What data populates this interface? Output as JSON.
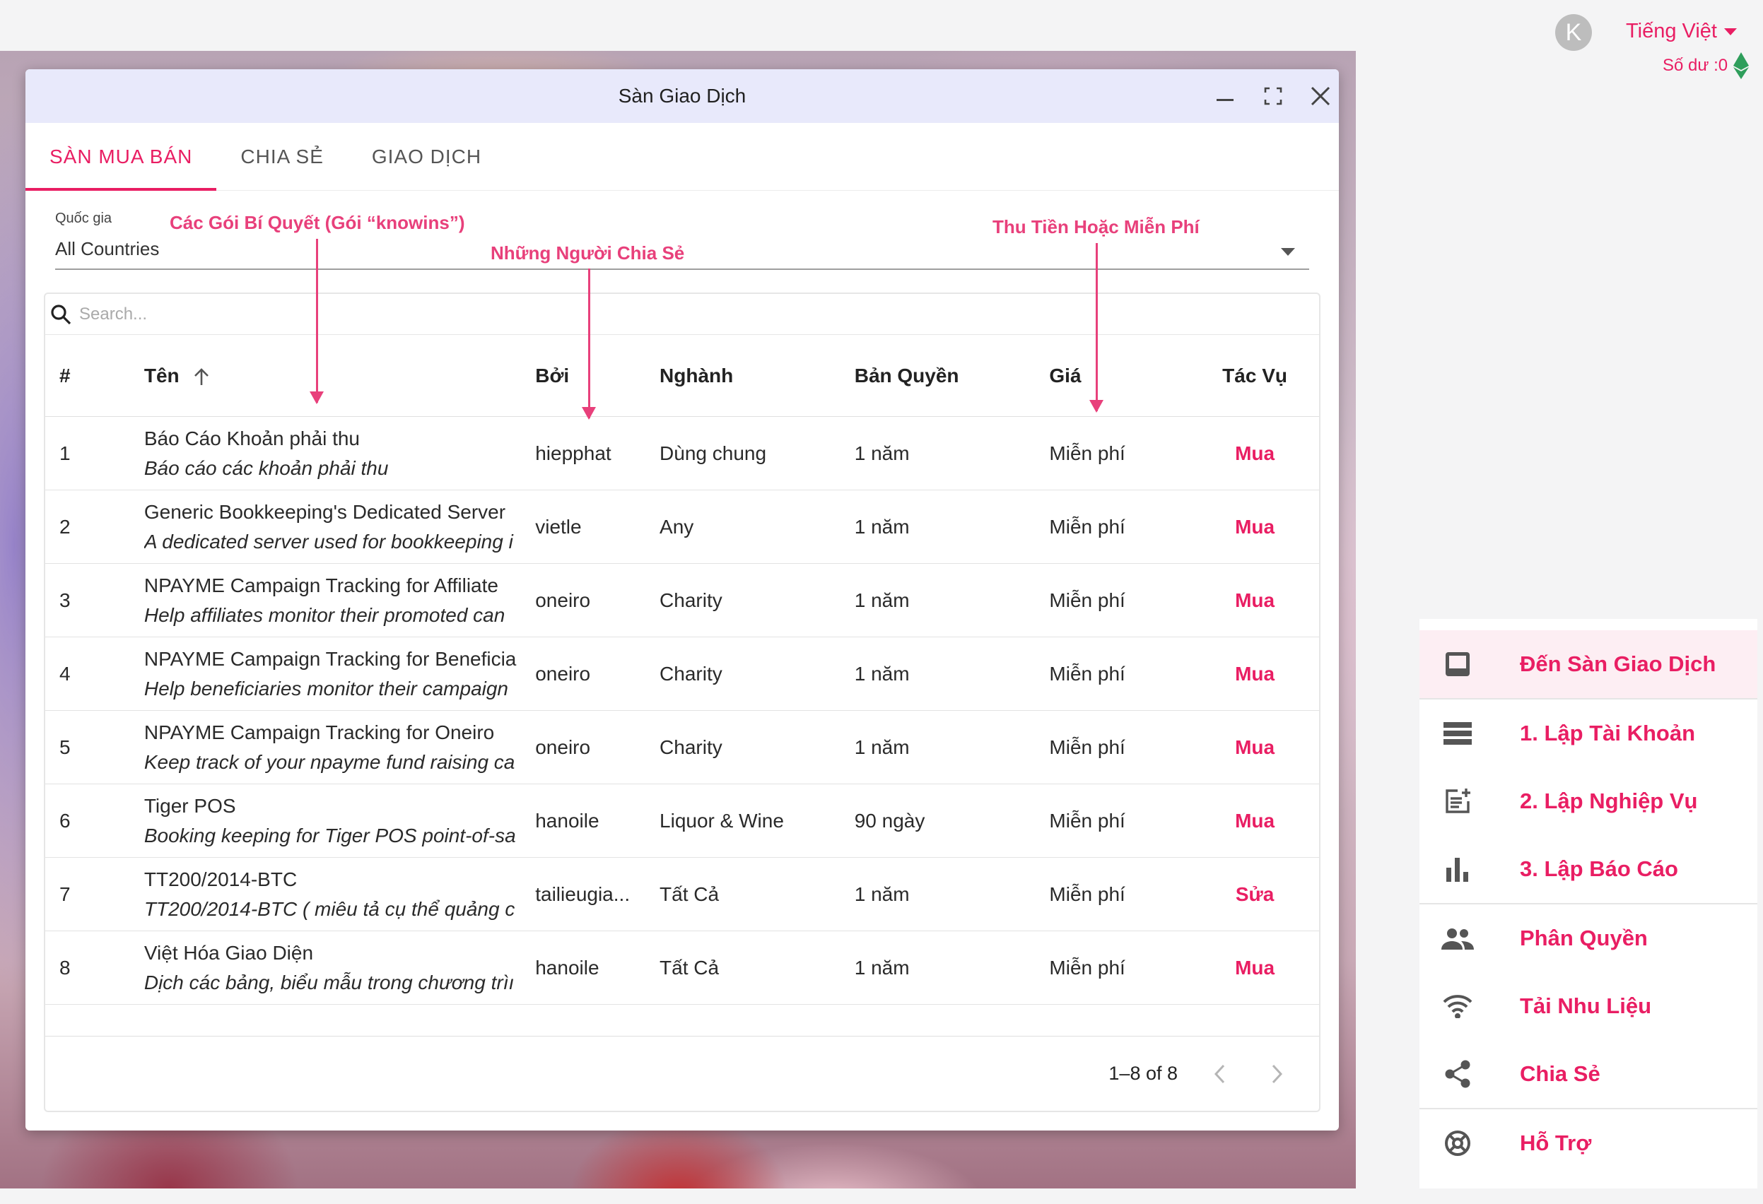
{
  "header": {
    "avatar_letter": "K",
    "language": "Tiếng Việt",
    "balance": "Số dư :0"
  },
  "window": {
    "title": "Sàn Giao Dịch",
    "tabs": [
      {
        "label": "SÀN MUA BÁN",
        "active": true
      },
      {
        "label": "CHIA SẺ",
        "active": false
      },
      {
        "label": "GIAO DỊCH",
        "active": false
      }
    ],
    "country": {
      "label": "Quốc gia",
      "value": "All Countries"
    },
    "search": {
      "placeholder": "Search..."
    },
    "columns": {
      "idx": "#",
      "name": "Tên",
      "by": "Bởi",
      "industry": "Nghành",
      "license": "Bản Quyền",
      "price": "Giá",
      "action": "Tác Vụ"
    },
    "rows": [
      {
        "idx": "1",
        "name": "Báo Cáo Khoản phải thu",
        "desc": "Báo cáo các khoản phải thu",
        "by": "hiepphat",
        "industry": "Dùng chung",
        "license": "1 năm",
        "price": "Miễn phí",
        "action": "Mua"
      },
      {
        "idx": "2",
        "name": "Generic Bookkeeping's Dedicated Server",
        "desc": "A dedicated server used for bookkeeping i",
        "by": "vietle",
        "industry": "Any",
        "license": "1 năm",
        "price": "Miễn phí",
        "action": "Mua"
      },
      {
        "idx": "3",
        "name": "NPAYME Campaign Tracking for Affiliate",
        "desc": "Help affiliates monitor their promoted can",
        "by": "oneiro",
        "industry": "Charity",
        "license": "1 năm",
        "price": "Miễn phí",
        "action": "Mua"
      },
      {
        "idx": "4",
        "name": "NPAYME Campaign Tracking for Beneficia",
        "desc": "Help beneficiaries monitor their campaign",
        "by": "oneiro",
        "industry": "Charity",
        "license": "1 năm",
        "price": "Miễn phí",
        "action": "Mua"
      },
      {
        "idx": "5",
        "name": "NPAYME Campaign Tracking for Oneiro",
        "desc": "Keep track of your npayme fund raising ca",
        "by": "oneiro",
        "industry": "Charity",
        "license": "1 năm",
        "price": "Miễn phí",
        "action": "Mua"
      },
      {
        "idx": "6",
        "name": "Tiger POS",
        "desc": "Booking keeping for Tiger POS point-of-sa",
        "by": "hanoile",
        "industry": "Liquor & Wine",
        "license": "90 ngày",
        "price": "Miễn phí",
        "action": "Mua"
      },
      {
        "idx": "7",
        "name": "TT200/2014-BTC",
        "desc": "TT200/2014-BTC ( miêu tả cụ thể quảng c",
        "by": "tailieugia...",
        "industry": "Tất Cả",
        "license": "1 năm",
        "price": "Miễn phí",
        "action": "Sửa"
      },
      {
        "idx": "8",
        "name": "Việt Hóa Giao Diện",
        "desc": "Dịch các bảng, biểu mẫu trong chương trìı",
        "by": "hanoile",
        "industry": "Tất Cả",
        "license": "1 năm",
        "price": "Miễn phí",
        "action": "Mua"
      }
    ],
    "pagination": "1–8 of 8"
  },
  "annotations": {
    "packages": "Các Gói Bí Quyết (Gói “knowins”)",
    "sharers": "Những Người Chia Sẻ",
    "price": "Thu Tiền Hoặc Miễn Phí"
  },
  "sidebar": {
    "items": [
      {
        "label": "Đến Sàn Giao Dịch",
        "icon": "inbox-icon",
        "active": true
      },
      {
        "label": "1. Lập Tài Khoản",
        "icon": "list-icon"
      },
      {
        "label": "2. Lập Nghiệp Vụ",
        "icon": "post-add-icon"
      },
      {
        "label": "3. Lập Báo Cáo",
        "icon": "bar-chart-icon"
      },
      {
        "label": "Phân Quyền",
        "icon": "people-icon"
      },
      {
        "label": "Tải Nhu Liệu",
        "icon": "wifi-icon"
      },
      {
        "label": "Chia Sẻ",
        "icon": "share-icon"
      },
      {
        "label": "Hỗ Trợ",
        "icon": "support-icon"
      }
    ]
  },
  "colors": {
    "accent": "#e91e63",
    "annotation": "#e8407b",
    "titlebar": "#e8e9fb"
  }
}
